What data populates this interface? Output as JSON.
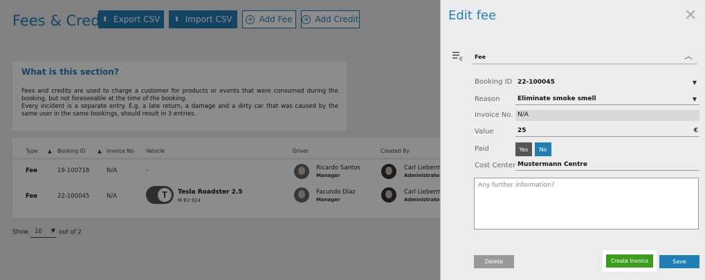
{
  "header": {
    "title": "Fees & Credits",
    "export_label": "Export CSV",
    "import_label": "Import CSV",
    "add_fee_label": "Add Fee",
    "add_credit_label": "Add Credit"
  },
  "info": {
    "title": "What is this section?",
    "text1": "Fees and credits are used to charge a customer for products or events that were consumed during the booking, but not foreseeable at the time of the booking.",
    "text2": "Every incident is a separate entry. E.g. a late return, a damage and a dirty car that was caused by the same user in the same bookings, should result in 3 entries."
  },
  "table": {
    "columns": [
      "Type",
      "Booking ID",
      "Invoice No.",
      "Vehicle",
      "Driver",
      "Created By"
    ],
    "rows": [
      {
        "type": "Fee",
        "booking_id": "19-100718",
        "invoice_no": "N/A",
        "vehicle": "-",
        "vehicle_plate": "",
        "driver_name": "Ricardo Santos",
        "driver_role": "Manager",
        "creator_name": "Carl Lieberm",
        "creator_role": "Administrato"
      },
      {
        "type": "Fee",
        "booking_id": "22-100045",
        "invoice_no": "N/A",
        "vehicle": "Tesla Roadster 2.5",
        "vehicle_plate": "M EV 914",
        "driver_name": "Facundo Diaz",
        "driver_role": "Manager",
        "creator_name": "Carl Lieberm",
        "creator_role": "Administrato"
      }
    ]
  },
  "pagination": {
    "show_label": "Show",
    "per_page": "10",
    "out_of": "out of 2"
  },
  "panel": {
    "title": "Edit fee",
    "section_label": "Fee",
    "booking_id_label": "Booking ID",
    "booking_id_value": "22-100045",
    "reason_label": "Reason",
    "reason_value": "Eliminate smoke smell",
    "invoice_label": "Invoice No.",
    "invoice_value": "N/A",
    "value_label": "Value",
    "value_value": "25",
    "currency": "€",
    "paid_label": "Paid",
    "paid_yes": "Yes",
    "paid_no": "No",
    "paid_selected": "No",
    "cost_center_label": "Cost Center",
    "cost_center_value": "Mustermann Centre",
    "notes_placeholder": "Any further information?",
    "delete_label": "Delete",
    "create_invoice_label": "Create Invoice",
    "save_label": "Save"
  },
  "colors": {
    "accent": "#1f7fb4",
    "create_green": "#3a9e1c"
  }
}
